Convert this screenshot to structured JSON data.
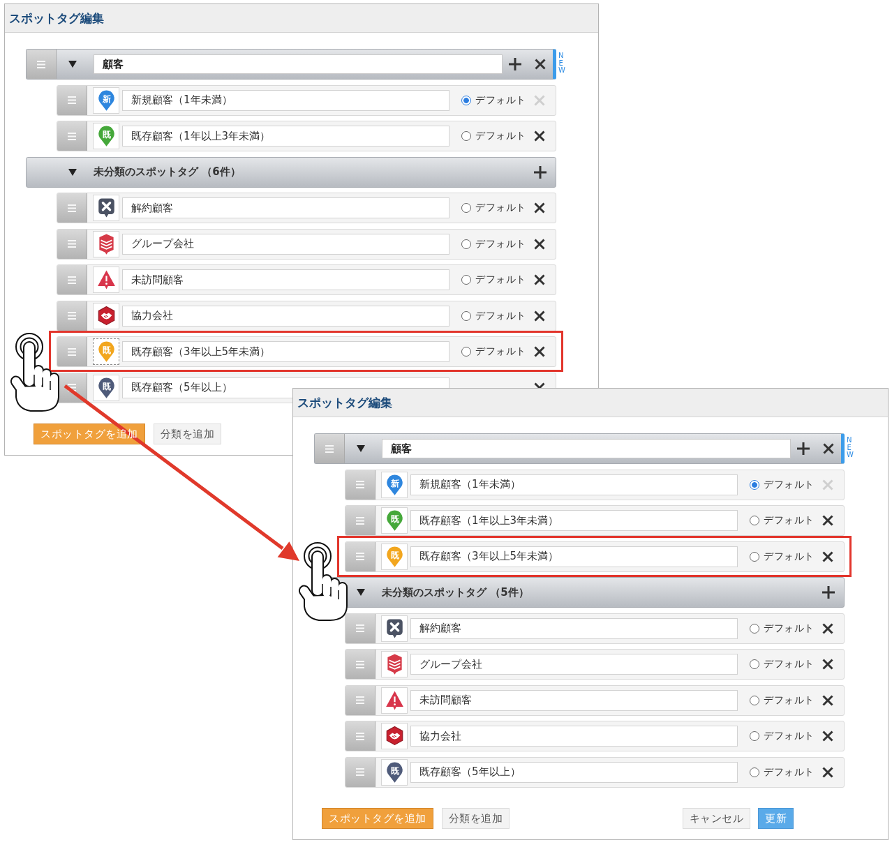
{
  "panels": [
    {
      "title": "スポットタグ編集",
      "groups": [
        {
          "kind": "category",
          "name": "顧客",
          "expanded": true,
          "badge": "NEW",
          "items": [
            {
              "name": "新規顧客（1年未満）",
              "icon": {
                "kind": "pin",
                "color": "#2e86de",
                "glyph": "新"
              },
              "default": {
                "label": "デフォルト",
                "selected": true
              },
              "removable": false,
              "highlighted": false,
              "dragging": false
            },
            {
              "name": "既存顧客（1年以上3年未満）",
              "icon": {
                "kind": "pin",
                "color": "#45a83a",
                "glyph": "既"
              },
              "default": {
                "label": "デフォルト",
                "selected": false
              },
              "removable": true,
              "highlighted": false,
              "dragging": false
            }
          ]
        },
        {
          "kind": "unclassified",
          "label": "未分類のスポットタグ （6件）",
          "expanded": true,
          "items": [
            {
              "name": "解約顧客",
              "icon": {
                "kind": "x-square"
              },
              "default": {
                "label": "デフォルト",
                "selected": false
              },
              "removable": true,
              "highlighted": false,
              "dragging": false
            },
            {
              "name": "グループ会社",
              "icon": {
                "kind": "building"
              },
              "default": {
                "label": "デフォルト",
                "selected": false
              },
              "removable": true,
              "highlighted": false,
              "dragging": false
            },
            {
              "name": "未訪問顧客",
              "icon": {
                "kind": "warning"
              },
              "default": {
                "label": "デフォルト",
                "selected": false
              },
              "removable": true,
              "highlighted": false,
              "dragging": false
            },
            {
              "name": "協力会社",
              "icon": {
                "kind": "handshake"
              },
              "default": {
                "label": "デフォルト",
                "selected": false
              },
              "removable": true,
              "highlighted": false,
              "dragging": false
            },
            {
              "name": "既存顧客（3年以上5年未満）",
              "icon": {
                "kind": "pin",
                "color": "#f2a61e",
                "glyph": "既"
              },
              "default": {
                "label": "デフォルト",
                "selected": false
              },
              "removable": true,
              "highlighted": true,
              "dragging": true
            },
            {
              "name": "既存顧客（5年以上）",
              "icon": {
                "kind": "pin",
                "color": "#4f5b7a",
                "glyph": "既"
              },
              "removable": true,
              "highlighted": false,
              "dragging": false
            }
          ]
        }
      ],
      "footer": {
        "left": [
          {
            "kind": "primary",
            "label": "スポットタグを追加"
          },
          {
            "kind": "secondary",
            "label": "分類を追加"
          }
        ]
      }
    },
    {
      "title": "スポットタグ編集",
      "groups": [
        {
          "kind": "category",
          "name": "顧客",
          "expanded": true,
          "badge": "NEW",
          "items": [
            {
              "name": "新規顧客（1年未満）",
              "icon": {
                "kind": "pin",
                "color": "#2e86de",
                "glyph": "新"
              },
              "default": {
                "label": "デフォルト",
                "selected": true
              },
              "removable": false,
              "highlighted": false,
              "dragging": false
            },
            {
              "name": "既存顧客（1年以上3年未満）",
              "icon": {
                "kind": "pin",
                "color": "#45a83a",
                "glyph": "既"
              },
              "default": {
                "label": "デフォルト",
                "selected": false
              },
              "removable": true,
              "highlighted": false,
              "dragging": false
            },
            {
              "name": "既存顧客（3年以上5年未満）",
              "icon": {
                "kind": "pin",
                "color": "#f2a61e",
                "glyph": "既"
              },
              "default": {
                "label": "デフォルト",
                "selected": false
              },
              "removable": true,
              "highlighted": true,
              "dragging": false
            }
          ]
        },
        {
          "kind": "unclassified",
          "label": "未分類のスポットタグ （5件）",
          "expanded": true,
          "items": [
            {
              "name": "解約顧客",
              "icon": {
                "kind": "x-square"
              },
              "default": {
                "label": "デフォルト",
                "selected": false
              },
              "removable": true,
              "highlighted": false,
              "dragging": false
            },
            {
              "name": "グループ会社",
              "icon": {
                "kind": "building"
              },
              "default": {
                "label": "デフォルト",
                "selected": false
              },
              "removable": true,
              "highlighted": false,
              "dragging": false
            },
            {
              "name": "未訪問顧客",
              "icon": {
                "kind": "warning"
              },
              "default": {
                "label": "デフォルト",
                "selected": false
              },
              "removable": true,
              "highlighted": false,
              "dragging": false
            },
            {
              "name": "協力会社",
              "icon": {
                "kind": "handshake"
              },
              "default": {
                "label": "デフォルト",
                "selected": false
              },
              "removable": true,
              "highlighted": false,
              "dragging": false
            },
            {
              "name": "既存顧客（5年以上）",
              "icon": {
                "kind": "pin",
                "color": "#4f5b7a",
                "glyph": "既"
              },
              "default": {
                "label": "デフォルト",
                "selected": false
              },
              "removable": true,
              "highlighted": false,
              "dragging": false
            }
          ]
        }
      ],
      "footer": {
        "left": [
          {
            "kind": "primary",
            "label": "スポットタグを追加"
          },
          {
            "kind": "secondary",
            "label": "分類を追加"
          }
        ],
        "right": [
          {
            "kind": "cancel",
            "label": "キャンセル"
          },
          {
            "kind": "submit",
            "label": "更新"
          }
        ]
      }
    }
  ]
}
